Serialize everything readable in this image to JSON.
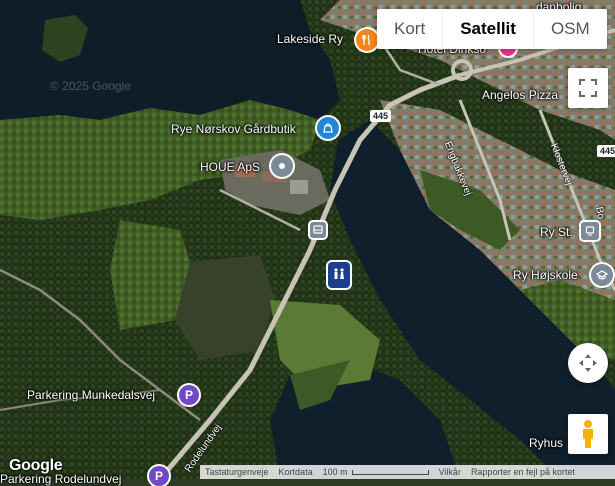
{
  "map_type": {
    "options": [
      "Kort",
      "Satellit",
      "OSM"
    ],
    "selected": "Satellit"
  },
  "labels": {
    "lakeside": "Lakeside Ry",
    "hotel": "Hotel Dinkso",
    "angelos": "Angelos Pizza",
    "danbolig": "danbolig",
    "rye": "Rye Nørskov Gårdbutik",
    "houe": "HOUE ApS",
    "rystation": "Ry St.",
    "ryhojskole": "Ry Højskole",
    "parkering1": "Parkering Munkedalsvej",
    "parkering2": "Parkering Rodelundvej",
    "ryhus": "Ryhus"
  },
  "roads": {
    "engbakkevej": "Engbakkevej",
    "klostervej": "Klostervej",
    "rodelundvej": "Rodelundvej",
    "route445": "445",
    "route445b": "445",
    "bo": "Bo"
  },
  "watermark": "© 2025 Google",
  "google_logo": "Google",
  "footer": {
    "shortcuts": "Tastaturgenveje",
    "mapdata": "Kortdata",
    "scale": "100 m",
    "terms": "Vilkår",
    "report": "Rapporter en fejl på kortet"
  },
  "colors": {
    "water": "#0e1e2a",
    "forest": "#233419",
    "field": "#4a6a2d",
    "road": "#b9b6ab",
    "poi_orange": "#f2861b",
    "poi_blue": "#1f87d6",
    "poi_gray": "#7b8a97",
    "poi_pink": "#e8358a",
    "poi_purple": "#6f49c8"
  }
}
